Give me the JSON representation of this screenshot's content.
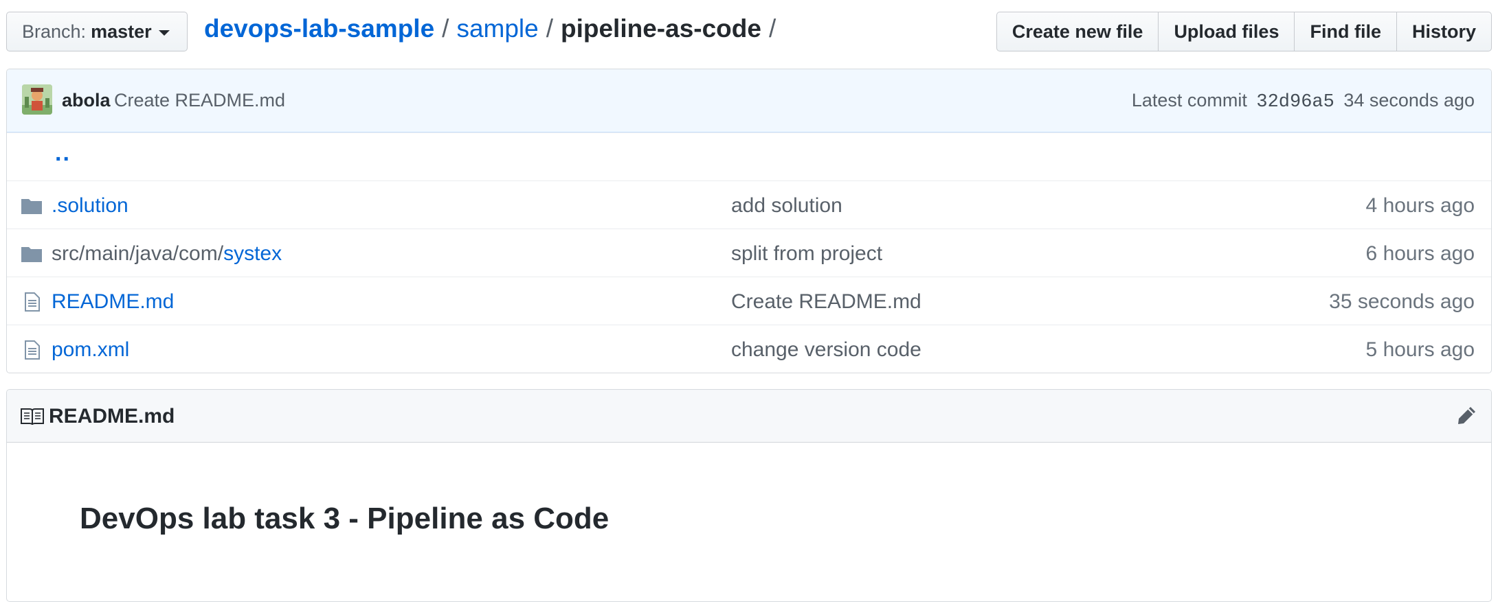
{
  "branch": {
    "label": "Branch:",
    "value": "master"
  },
  "breadcrumb": {
    "repo": "devops-lab-sample",
    "folder": "sample",
    "current": "pipeline-as-code",
    "separator": "/"
  },
  "actions": {
    "create_new_file": "Create new file",
    "upload_files": "Upload files",
    "find_file": "Find file",
    "history": "History"
  },
  "commit": {
    "author": "abola",
    "message": "Create README.md",
    "latest_label": "Latest commit",
    "sha": "32d96a5",
    "age": "34 seconds ago"
  },
  "parent_link": "..",
  "files": [
    {
      "type": "dir",
      "name_prefix": "",
      "name": ".solution",
      "message": "add solution",
      "age": "4 hours ago"
    },
    {
      "type": "dir",
      "name_prefix": "src/main/java/com/",
      "name": "systex",
      "message": "split from project",
      "age": "6 hours ago"
    },
    {
      "type": "file",
      "name_prefix": "",
      "name": "README.md",
      "message": "Create README.md",
      "age": "35 seconds ago"
    },
    {
      "type": "file",
      "name_prefix": "",
      "name": "pom.xml",
      "message": "change version code",
      "age": "5 hours ago"
    }
  ],
  "readme": {
    "filename": "README.md",
    "heading": "DevOps lab task 3 - Pipeline as Code"
  },
  "colors": {
    "link": "#0366d6",
    "commit_bar_bg": "#f1f8ff",
    "icon": "#8094a8"
  }
}
